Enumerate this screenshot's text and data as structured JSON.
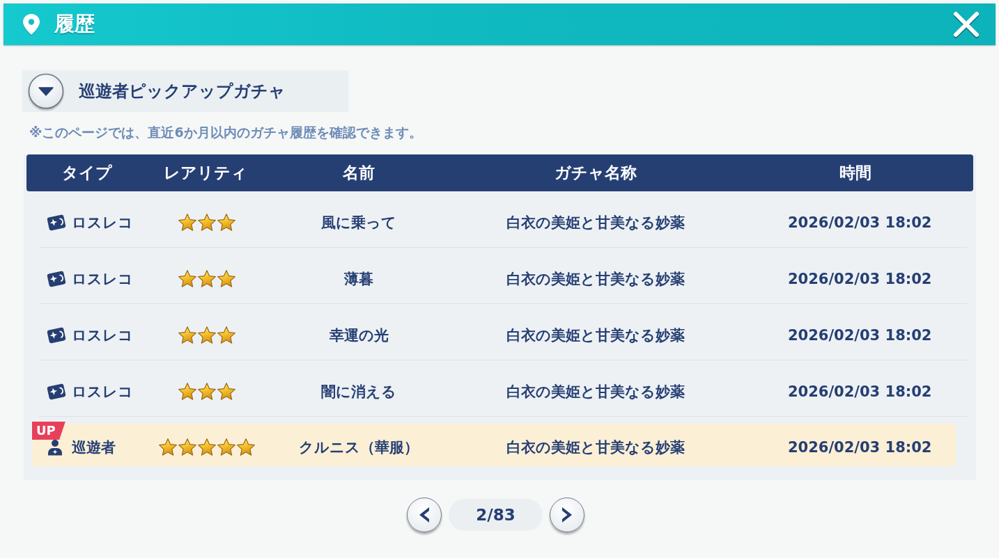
{
  "header": {
    "title": "履歴"
  },
  "gacha_selector": {
    "label": "巡遊者ピックアップガチャ"
  },
  "note": "※このページでは、直近6か月以内のガチャ履歴を確認できます。",
  "table": {
    "columns": [
      "タイプ",
      "レアリティ",
      "名前",
      "ガチャ名称",
      "時間"
    ],
    "rows": [
      {
        "kind": "record",
        "type": "ロスレコ",
        "stars": 3,
        "name": "風に乗って",
        "gacha": "白衣の美姫と甘美なる妙薬",
        "time": "2026/02/03 18:02",
        "highlighted": false
      },
      {
        "kind": "record",
        "type": "ロスレコ",
        "stars": 3,
        "name": "薄暮",
        "gacha": "白衣の美姫と甘美なる妙薬",
        "time": "2026/02/03 18:02",
        "highlighted": false
      },
      {
        "kind": "record",
        "type": "ロスレコ",
        "stars": 3,
        "name": "幸運の光",
        "gacha": "白衣の美姫と甘美なる妙薬",
        "time": "2026/02/03 18:02",
        "highlighted": false
      },
      {
        "kind": "record",
        "type": "ロスレコ",
        "stars": 3,
        "name": "闇に消える",
        "gacha": "白衣の美姫と甘美なる妙薬",
        "time": "2026/02/03 18:02",
        "highlighted": false
      },
      {
        "kind": "traveler",
        "type": "巡遊者",
        "stars": 5,
        "name": "クルニス（華服）",
        "gacha": "白衣の美姫と甘美なる妙薬",
        "time": "2026/02/03 18:02",
        "highlighted": true,
        "badge": "UP"
      }
    ]
  },
  "pagination": {
    "page": "2/83"
  }
}
